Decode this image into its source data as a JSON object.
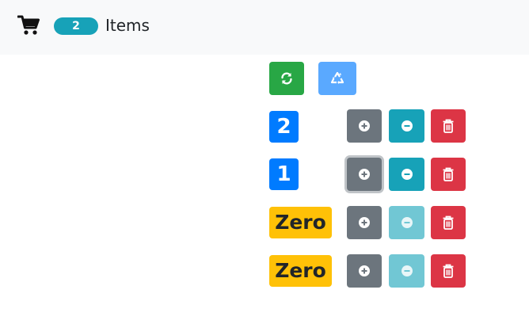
{
  "navbar": {
    "cart_icon": "shopping-cart-icon",
    "total_items": "2",
    "items_label": "Items"
  },
  "actions": {
    "refresh_icon": "refresh-icon",
    "recycle_icon": "recycle-icon"
  },
  "counters": [
    {
      "badge": "2",
      "badge_style": "primary",
      "decrement_disabled": false
    },
    {
      "badge": "1",
      "badge_style": "primary",
      "decrement_disabled": false,
      "increment_focused": true
    },
    {
      "badge": "Zero",
      "badge_style": "warning",
      "decrement_disabled": true
    },
    {
      "badge": "Zero",
      "badge_style": "warning",
      "decrement_disabled": true
    }
  ],
  "colors": {
    "navbar_bg": "#f8f9fa",
    "pill": "#17a2b8",
    "refresh": "#28a745",
    "recycle": "#5aa9ff",
    "badge_primary": "#007bff",
    "badge_warning": "#ffc107",
    "increment": "#6c757d",
    "decrement": "#17a2b8",
    "delete": "#dc3545"
  }
}
